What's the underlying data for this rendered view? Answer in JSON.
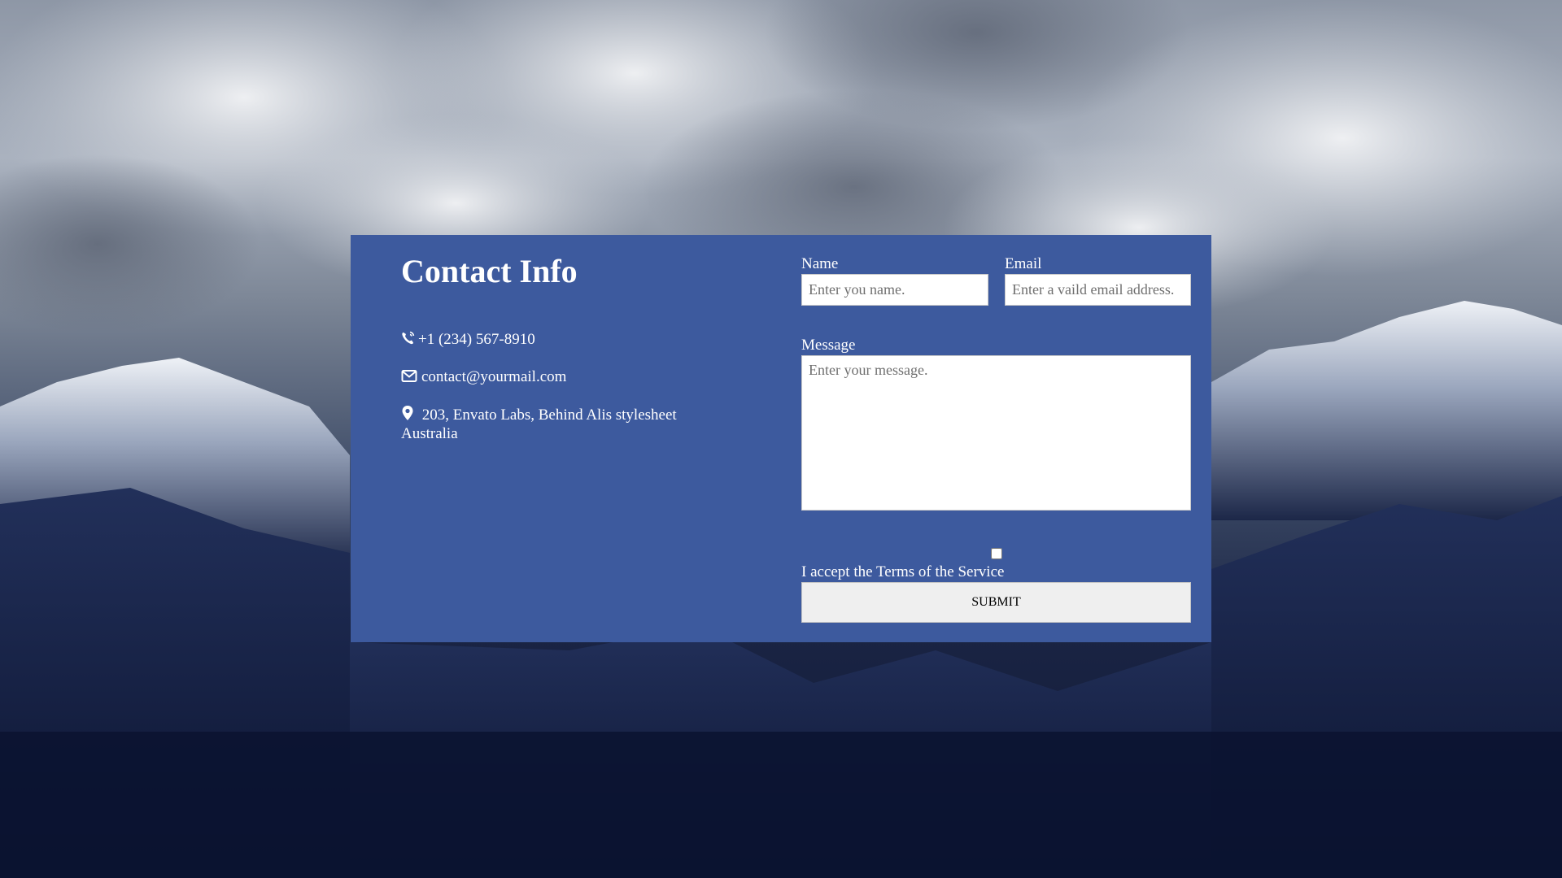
{
  "contact": {
    "title": "Contact Info",
    "phone": "+1 (234) 567-8910",
    "email": "contact@yourmail.com",
    "address_line1": "203, Envato Labs, Behind Alis stylesheet",
    "address_line2": "Australia",
    "icons": [
      "phone-icon",
      "envelope-icon",
      "map-marker-icon"
    ]
  },
  "form": {
    "name_label": "Name",
    "name_placeholder": "Enter you name.",
    "email_label": "Email",
    "email_placeholder": "Enter a vaild email address.",
    "message_label": "Message",
    "message_placeholder": "Enter your message.",
    "terms_label": "I accept the Terms of the Service",
    "terms_checked": false,
    "submit_label": "SUBMIT"
  },
  "colors": {
    "card_background": "#3d5a9e",
    "text": "#ffffff"
  }
}
